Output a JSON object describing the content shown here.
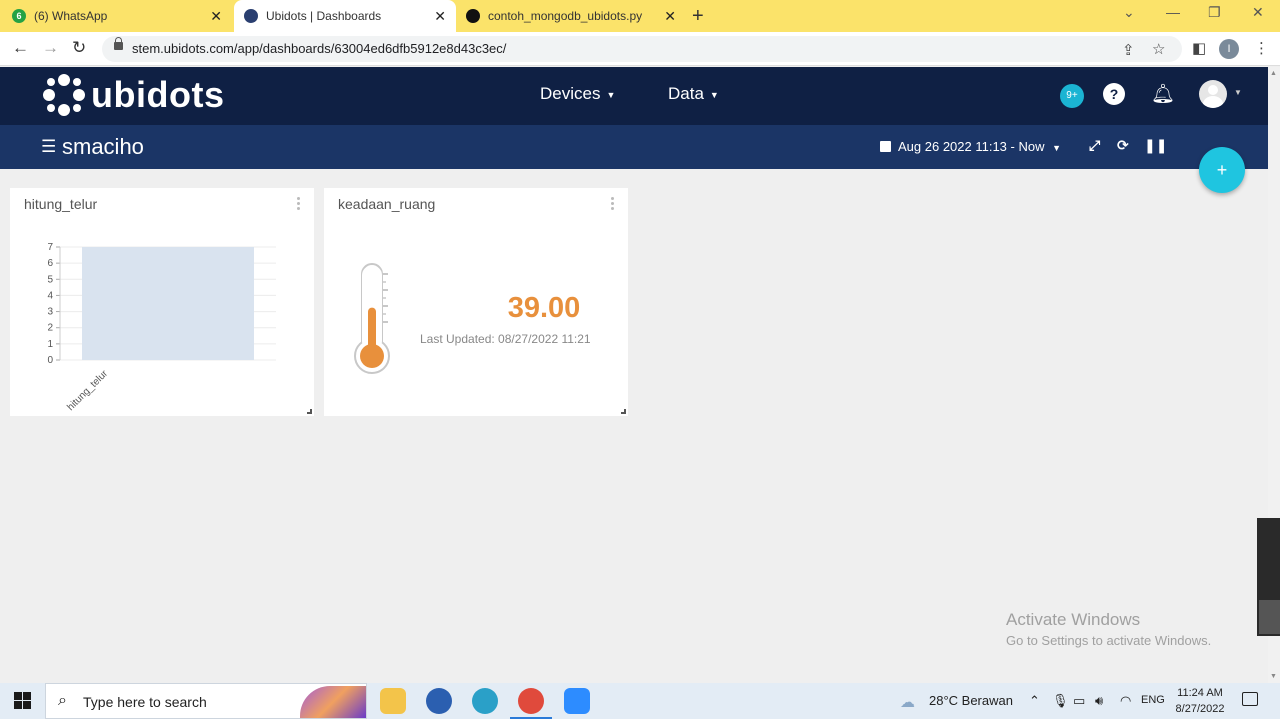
{
  "browser": {
    "tabs": [
      {
        "label": "(6) WhatsApp",
        "badge": "6",
        "active": false
      },
      {
        "label": "Ubidots | Dashboards",
        "active": true
      },
      {
        "label": "contoh_mongodb_ubidots.py",
        "active": false
      }
    ],
    "url": "stem.ubidots.com/app/dashboards/63004ed6dfb5912e8d43c3ec/",
    "profile_initial": "I"
  },
  "app": {
    "logo_text": "ubidots",
    "menu": [
      {
        "label": "Devices"
      },
      {
        "label": "Data"
      }
    ],
    "notification_badge": "9+",
    "help_label": "?"
  },
  "dashboard": {
    "name": "smaciho",
    "date_range": "Aug 26 2022 11:13 - Now",
    "add_label": "+"
  },
  "widgets": {
    "chart_widget": {
      "title": "hitung_telur"
    },
    "thermo_widget": {
      "title": "keadaan_ruang",
      "value": "39.00",
      "last_updated": "Last Updated: 08/27/2022 11:21",
      "value_color": "#e8903c",
      "level_fraction": 0.55
    }
  },
  "chart_data": {
    "type": "bar",
    "title": "hitung_telur",
    "categories": [
      "hitung_telur"
    ],
    "values": [
      7
    ],
    "ylim": [
      0,
      7
    ],
    "yticks": [
      "0",
      "1",
      "2",
      "3",
      "4",
      "5",
      "6",
      "7"
    ],
    "xlabel": "",
    "ylabel": "",
    "bar_color": "#d9e3ef",
    "grid": true
  },
  "watermark": {
    "line1": "Activate Windows",
    "line2": "Go to Settings to activate Windows."
  },
  "taskbar": {
    "search_placeholder": "Type here to search",
    "weather": "28°C  Berawan",
    "language": "ENG",
    "time": "11:24 AM",
    "date": "8/27/2022"
  }
}
